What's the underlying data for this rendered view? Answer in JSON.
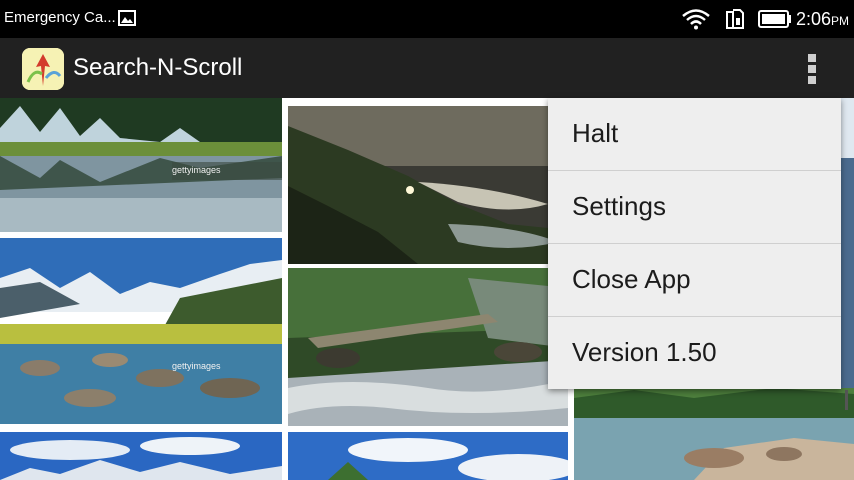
{
  "status_bar": {
    "notification_text": "Emergency Ca...",
    "time": "2:06",
    "ampm": "PM",
    "icons": [
      "image-icon",
      "wifi-icon",
      "sim-icon",
      "battery-icon"
    ]
  },
  "action_bar": {
    "title": "Search-N-Scroll",
    "icons": [
      "app-icon",
      "overflow-menu-icon"
    ]
  },
  "grid": {
    "photo_watermarks": [
      "gettyimages",
      "gettyimages"
    ]
  },
  "menu": {
    "items": [
      {
        "label": "Halt"
      },
      {
        "label": "Settings"
      },
      {
        "label": "Close App"
      },
      {
        "label": "Version 1.50"
      }
    ]
  },
  "colors": {
    "status_bar_bg": "#000000",
    "action_bar_bg": "#212121",
    "menu_bg": "#eeeeee",
    "menu_text": "#1c1c1c"
  }
}
